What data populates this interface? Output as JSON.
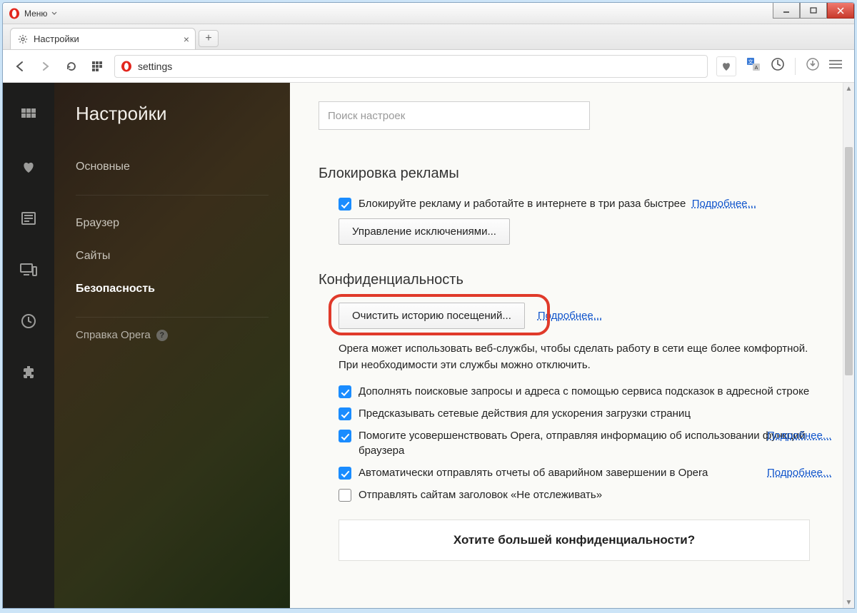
{
  "titlebar": {
    "menu_label": "Меню"
  },
  "tab": {
    "title": "Настройки"
  },
  "addressbar": {
    "value": "settings"
  },
  "sidebar": {
    "title": "Настройки",
    "items": {
      "basic": "Основные",
      "browser": "Браузер",
      "sites": "Сайты",
      "security": "Безопасность"
    },
    "help": "Справка Opera"
  },
  "main": {
    "search_placeholder": "Поиск настроек",
    "adblock": {
      "heading": "Блокировка рекламы",
      "checkbox_label": "Блокируйте рекламу и работайте в интернете в три раза быстрее",
      "more": "Подробнее...",
      "manage_btn": "Управление исключениями..."
    },
    "privacy": {
      "heading": "Конфиденциальность",
      "clear_btn": "Очистить историю посещений...",
      "more": "Подробнее...",
      "description": "Opera может использовать веб-службы, чтобы сделать работу в сети еще более комфортной. При необходимости эти службы можно отключить.",
      "opt1": "Дополнять поисковые запросы и адреса с помощью сервиса подсказок в адресной строке",
      "opt2": "Предсказывать сетевые действия для ускорения загрузки страниц",
      "opt3": "Помогите усовершенствовать Opera, отправляя информацию об использовании функций браузера",
      "opt3_more": "Подробнее...",
      "opt4": "Автоматически отправлять отчеты об аварийном завершении в Opera",
      "opt4_more": "Подробнее...",
      "opt5": "Отправлять сайтам заголовок «Не отслеживать»",
      "promo": "Хотите большей конфиденциальности?"
    }
  }
}
